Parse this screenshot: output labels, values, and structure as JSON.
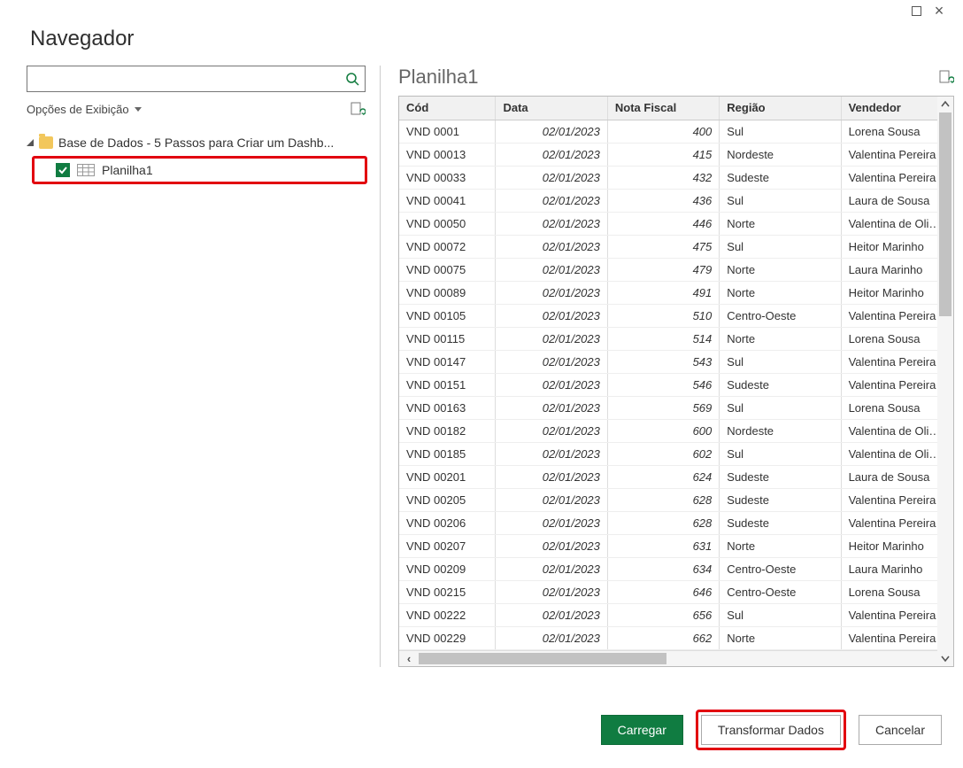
{
  "window": {
    "title": "Navegador"
  },
  "search": {
    "placeholder": ""
  },
  "options": {
    "label": "Opções de Exibição"
  },
  "tree": {
    "parent": "Base de Dados - 5 Passos para Criar um Dashb...",
    "child": "Planilha1"
  },
  "preview": {
    "title": "Planilha1",
    "columns": [
      "Cód",
      "Data",
      "Nota Fiscal",
      "Região",
      "Vendedor"
    ],
    "rows": [
      {
        "cod": "VND 0001",
        "data": "02/01/2023",
        "nota": "400",
        "reg": "Sul",
        "ven": "Lorena Sousa"
      },
      {
        "cod": "VND 00013",
        "data": "02/01/2023",
        "nota": "415",
        "reg": "Nordeste",
        "ven": "Valentina Pereira"
      },
      {
        "cod": "VND 00033",
        "data": "02/01/2023",
        "nota": "432",
        "reg": "Sudeste",
        "ven": "Valentina Pereira"
      },
      {
        "cod": "VND 00041",
        "data": "02/01/2023",
        "nota": "436",
        "reg": "Sul",
        "ven": "Laura de Sousa"
      },
      {
        "cod": "VND 00050",
        "data": "02/01/2023",
        "nota": "446",
        "reg": "Norte",
        "ven": "Valentina de Oliveir"
      },
      {
        "cod": "VND 00072",
        "data": "02/01/2023",
        "nota": "475",
        "reg": "Sul",
        "ven": "Heitor Marinho"
      },
      {
        "cod": "VND 00075",
        "data": "02/01/2023",
        "nota": "479",
        "reg": "Norte",
        "ven": "Laura Marinho"
      },
      {
        "cod": "VND 00089",
        "data": "02/01/2023",
        "nota": "491",
        "reg": "Norte",
        "ven": "Heitor Marinho"
      },
      {
        "cod": "VND 00105",
        "data": "02/01/2023",
        "nota": "510",
        "reg": "Centro-Oeste",
        "ven": "Valentina Pereira"
      },
      {
        "cod": "VND 00115",
        "data": "02/01/2023",
        "nota": "514",
        "reg": "Norte",
        "ven": "Lorena Sousa"
      },
      {
        "cod": "VND 00147",
        "data": "02/01/2023",
        "nota": "543",
        "reg": "Sul",
        "ven": "Valentina Pereira"
      },
      {
        "cod": "VND 00151",
        "data": "02/01/2023",
        "nota": "546",
        "reg": "Sudeste",
        "ven": "Valentina Pereira"
      },
      {
        "cod": "VND 00163",
        "data": "02/01/2023",
        "nota": "569",
        "reg": "Sul",
        "ven": "Lorena Sousa"
      },
      {
        "cod": "VND 00182",
        "data": "02/01/2023",
        "nota": "600",
        "reg": "Nordeste",
        "ven": "Valentina de Oliveir"
      },
      {
        "cod": "VND 00185",
        "data": "02/01/2023",
        "nota": "602",
        "reg": "Sul",
        "ven": "Valentina de Oliveir"
      },
      {
        "cod": "VND 00201",
        "data": "02/01/2023",
        "nota": "624",
        "reg": "Sudeste",
        "ven": "Laura de Sousa"
      },
      {
        "cod": "VND 00205",
        "data": "02/01/2023",
        "nota": "628",
        "reg": "Sudeste",
        "ven": "Valentina Pereira"
      },
      {
        "cod": "VND 00206",
        "data": "02/01/2023",
        "nota": "628",
        "reg": "Sudeste",
        "ven": "Valentina Pereira"
      },
      {
        "cod": "VND 00207",
        "data": "02/01/2023",
        "nota": "631",
        "reg": "Norte",
        "ven": "Heitor Marinho"
      },
      {
        "cod": "VND 00209",
        "data": "02/01/2023",
        "nota": "634",
        "reg": "Centro-Oeste",
        "ven": "Laura Marinho"
      },
      {
        "cod": "VND 00215",
        "data": "02/01/2023",
        "nota": "646",
        "reg": "Centro-Oeste",
        "ven": "Lorena Sousa"
      },
      {
        "cod": "VND 00222",
        "data": "02/01/2023",
        "nota": "656",
        "reg": "Sul",
        "ven": "Valentina Pereira"
      },
      {
        "cod": "VND 00229",
        "data": "02/01/2023",
        "nota": "662",
        "reg": "Norte",
        "ven": "Valentina Pereira"
      }
    ]
  },
  "buttons": {
    "load": "Carregar",
    "transform": "Transformar Dados",
    "cancel": "Cancelar"
  }
}
